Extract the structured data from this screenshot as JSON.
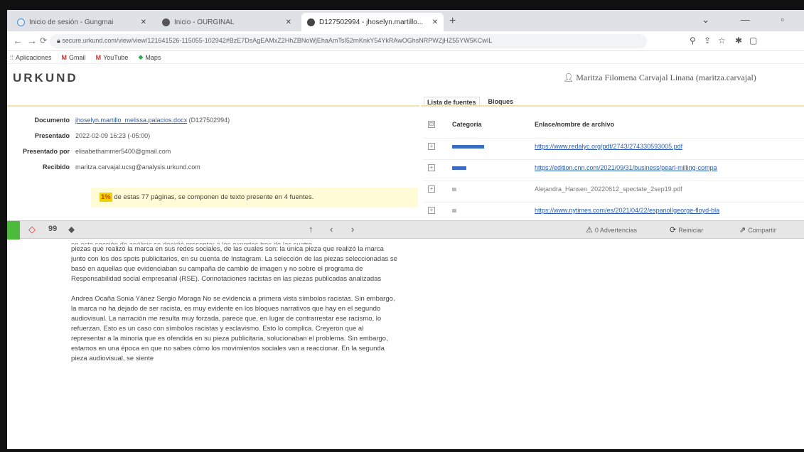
{
  "browser": {
    "tabs": [
      {
        "title": "Inicio de sesión - Gungmai",
        "active": false
      },
      {
        "title": "Inicio - OURGINAL",
        "active": false
      },
      {
        "title": "D127502994 - jhoselyn.martillo...",
        "active": true
      }
    ],
    "url": "secure.urkund.com/view/view/121641526-115055-102942#BzE7DsAgEAMxZ2HhZBNoWjEhaAmTsI52rnKnkY54YkRAwOGhsNRPWZjHZ55YW5KCwIL",
    "bookmarks": [
      "Aplicaciones",
      "Gmail",
      "YouTube",
      "Maps"
    ]
  },
  "app": {
    "logo": "URKUND",
    "user": "Maritza Filomena Carvajal Linana (maritza.carvajal)",
    "panel_tabs": [
      "Lista de fuentes",
      "Bloques"
    ]
  },
  "document_info": {
    "documento_label": "Documento",
    "documento_link": "jhoselyn.martillo_melissa.palacios.docx",
    "documento_id": "(D127502994)",
    "presentado_label": "Presentado",
    "presentado_value": "2022-02-09 16:23 (-05:00)",
    "presentado_por_label": "Presentado por",
    "presentado_por_value": "elisabethammer5400@gmail.com",
    "recibido_label": "Recibido",
    "recibido_value": "maritza.carvajal.ucsg@analysis.urkund.com",
    "percent": "1%",
    "summary_text": "de estas 77 páginas, se componen de texto presente en 4 fuentes."
  },
  "sources": {
    "header_categoria": "Categoría",
    "header_enlace": "Enlace/nombre de archivo",
    "rows": [
      {
        "link": "https://www.redalyc.org/pdf/2743/274330593005.pdf",
        "match": 0.9
      },
      {
        "link": "https://edition.cnn.com/2021/09/31/business/pearl-milling-compa",
        "match": 0.4
      },
      {
        "link": "Alejandra_Hansen_20220612_spectate_2sep19.pdf",
        "match": 0.1
      },
      {
        "link": "https://www.nytimes.com/es/2021/04/22/espanol/george-floyd-bla",
        "match": 0.1
      }
    ]
  },
  "toolbar": {
    "quote_icon": "99",
    "warnings": "0 Advertencias",
    "reset": "Reiniciar",
    "share": "Compartir"
  },
  "body": {
    "cut_line": "en esta sección de análisis se decidió presentar a los expertos tres de las cuatro",
    "p1": "piezas que realizó la marca en sus redes sociales, de las cuales son: la única pieza que realizó la marca junto con los dos spots publicitarios, en su cuenta de Instagram. La selección de las piezas seleccionadas se basó en aquellas que evidenciaban su campaña de cambio de imagen y no sobre el programa de Responsabilidad social empresarial (RSE). Connotaciones racistas en las piezas publicadas analizadas",
    "p2": "Andrea Ocaña Sonia Yánez Sergio Moraga No se evidencia a primera vista símbolos racistas. Sin embargo, la marca no ha dejado de ser racista, es muy evidente en los bloques narrativos que hay en el segundo audiovisual. La narración me resulta muy forzada, parece que, en lugar de contrarrestar ese racismo, lo refuerzan. Esto es un caso con símbolos racistas y esclavismo. Esto lo complica. Creyeron que al representar a la minoría que es ofendida en su pieza publicitaria, solucionaban el problema. Sin embargo, estamos en una época en que no sabes cómo los movimientos sociales van a reaccionar. En la segunda pieza audiovisual, se siente"
  }
}
